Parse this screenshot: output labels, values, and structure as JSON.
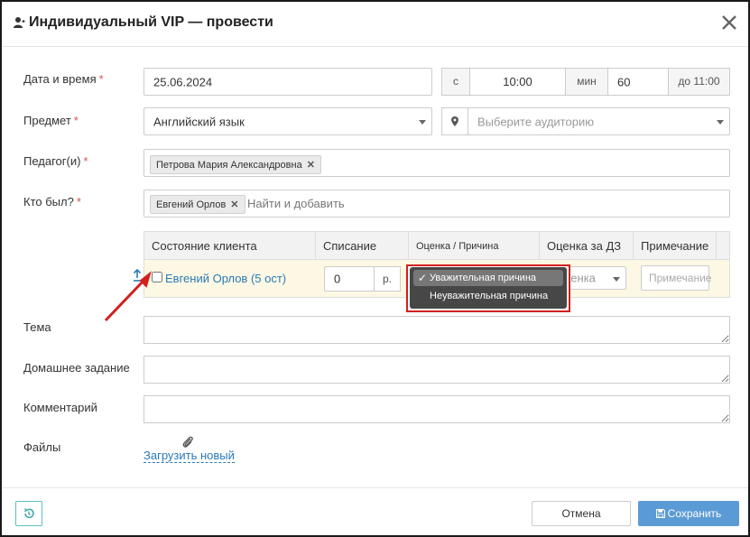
{
  "dialog": {
    "title": "Индивидуальный VIP — провести",
    "close_icon": "close-icon",
    "title_icon": "user-icon"
  },
  "form": {
    "datetime": {
      "label": "Дата и время",
      "required_mark": "*",
      "date_value": "25.06.2024",
      "from_label": "с",
      "time_value": "10:00",
      "duration_label": "мин",
      "duration_value": "60",
      "until_label": "до 11:00"
    },
    "subject": {
      "label": "Предмет",
      "required_mark": "*",
      "value": "Английский язык",
      "room_placeholder": "Выберите аудиторию",
      "room_icon": "location-pin-icon"
    },
    "teachers": {
      "label": "Педагог(и)",
      "required_mark": "*",
      "tags": [
        "Петрова Мария Александровна"
      ]
    },
    "attendees": {
      "label": "Кто был?",
      "required_mark": "*",
      "tags": [
        "Евгений Орлов"
      ],
      "placeholder": "Найти и добавить"
    },
    "table": {
      "headers": [
        "Состояние клиента",
        "Списание",
        "Оценка / Причина",
        "Оценка за ДЗ",
        "Примечание"
      ],
      "row": {
        "client": "Евгений Орлов (5 ост)",
        "write_off_value": "0",
        "currency": "р.",
        "grade_hw_partial": "ценка",
        "note_placeholder": "Примечание",
        "checked": false
      }
    },
    "topic": {
      "label": "Тема",
      "value": ""
    },
    "homework": {
      "label": "Домашнее задание",
      "value": ""
    },
    "comment": {
      "label": "Комментарий",
      "value": ""
    },
    "files": {
      "label": "Файлы",
      "upload_link": "Загрузить новый",
      "attach_icon": "paperclip-icon"
    }
  },
  "dropdown": {
    "options": [
      "Уважительная причина",
      "Неуважительная причина"
    ],
    "selected_index": 0
  },
  "footer": {
    "history_icon": "history-icon",
    "cancel_label": "Отмена",
    "save_label": "Сохранить",
    "save_icon": "floppy-disk-icon"
  },
  "colors": {
    "required": "#d9534f",
    "link": "#2a7ab8",
    "primary_button": "#5b9bd5",
    "row_highlight": "#fcf8e3",
    "highlight_box": "#d21f1f",
    "dropdown_bg": "#474747"
  }
}
